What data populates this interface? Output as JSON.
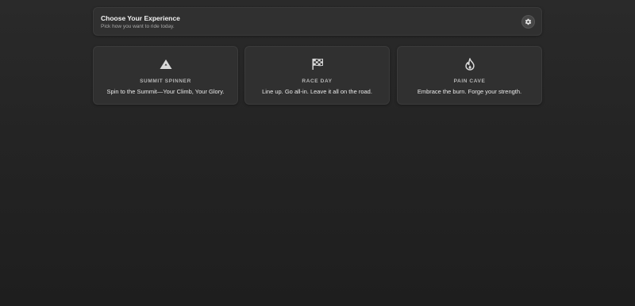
{
  "header": {
    "title": "Choose Your Experience",
    "subtitle": "Pick how you want to ride today.",
    "settings_icon": "gear-icon"
  },
  "cards": [
    {
      "icon": "mountain-icon",
      "label": "SUMMIT SPINNER",
      "tagline": "Spin to the Summit—Your Climb, Your Glory."
    },
    {
      "icon": "checkered-flag-icon",
      "label": "RACE DAY",
      "tagline": "Line up. Go all-in. Leave it all on the road."
    },
    {
      "icon": "flame-icon",
      "label": "PAIN CAVE",
      "tagline": "Embrace the burn. Forge your strength."
    }
  ],
  "colors": {
    "background": "#242424",
    "panel": "#303030",
    "text": "#eaeaea",
    "muted_text": "#b5b5b5"
  }
}
